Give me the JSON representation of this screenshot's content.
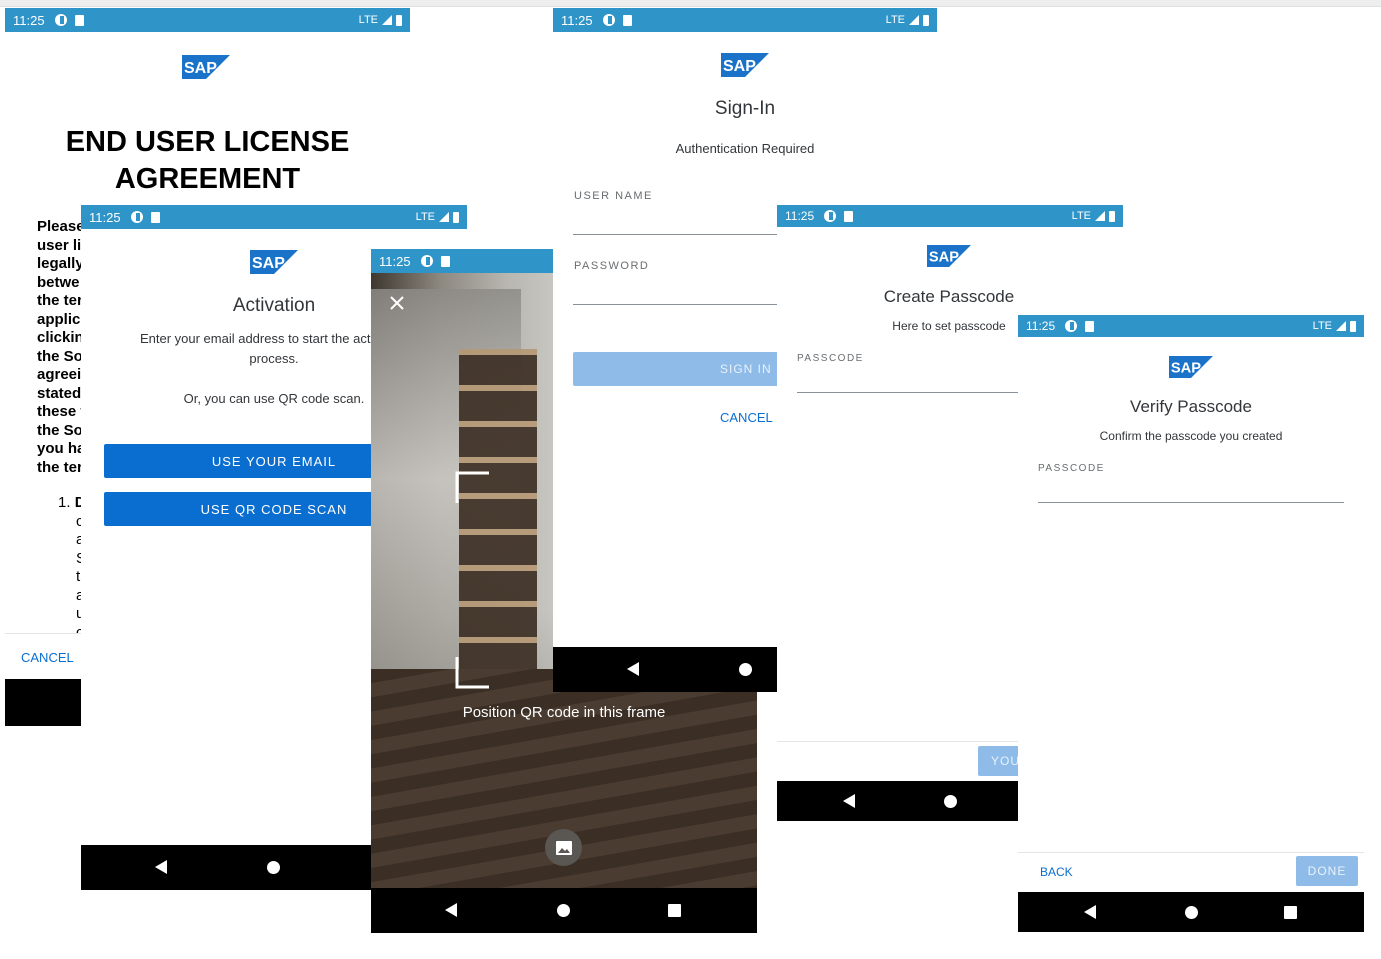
{
  "status": {
    "time": "11:25",
    "network": "LTE"
  },
  "logo": {
    "text": "SAP",
    "brand_color": "#0a6ed1"
  },
  "eula": {
    "title": "END USER LICENSE AGREEMENT",
    "body_lines": [
      "Please",
      "user li",
      "legally",
      "betwe",
      "the ter",
      "applic",
      "clickin",
      "the So",
      "agreei",
      "stated",
      "these t",
      "the So",
      "you ha",
      "the ter"
    ],
    "list_number": "1. ",
    "list_bold": "D",
    "list_lines": [
      "c",
      "a",
      "S",
      "t",
      "a",
      "u",
      "c"
    ],
    "cancel_label": "CANCEL"
  },
  "activation": {
    "title": "Activation",
    "desc": "Enter your email address to start the activation process.",
    "desc_alt": "Or, you can use QR code scan.",
    "email_button": "USE YOUR EMAIL",
    "qr_button": "USE QR CODE SCAN"
  },
  "qr_scanner": {
    "close_icon": "close-icon",
    "hint": "Position QR code in this frame",
    "gallery_icon": "image-icon"
  },
  "signin": {
    "title": "Sign-In",
    "subtitle": "Authentication Required",
    "username_label": "USER NAME",
    "password_label": "PASSWORD",
    "signin_button": "SIGN IN",
    "cancel_label": "CANCEL"
  },
  "create_passcode": {
    "title": "Create Passcode",
    "subtitle": "Here to set passcode",
    "passcode_label": "PASSCODE",
    "next_button": "YOU"
  },
  "verify_passcode": {
    "title": "Verify Passcode",
    "subtitle": "Confirm the passcode you created",
    "passcode_label": "PASSCODE",
    "back_label": "BACK",
    "done_label": "DONE"
  }
}
